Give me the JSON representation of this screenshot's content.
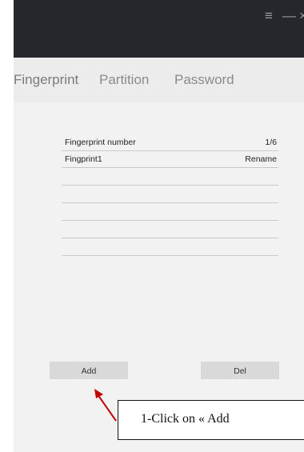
{
  "window": {
    "controls": {
      "menu": "≡",
      "minimize": "—",
      "close": "×"
    }
  },
  "tabs": [
    {
      "label": "Fingerprint",
      "active": true
    },
    {
      "label": "Partition",
      "active": false
    },
    {
      "label": "Password",
      "active": false
    }
  ],
  "fingerprint_list": {
    "header": {
      "title": "Fingerprint number",
      "count": "1/6"
    },
    "items": [
      {
        "name": "Fingprint1",
        "action": "Rename"
      }
    ]
  },
  "buttons": {
    "add": "Add",
    "delete": "Del"
  },
  "annotation": {
    "text": "1-Click on « Add"
  },
  "colors": {
    "titlebar": "#26262d",
    "annotation_arrow": "#c00000"
  }
}
